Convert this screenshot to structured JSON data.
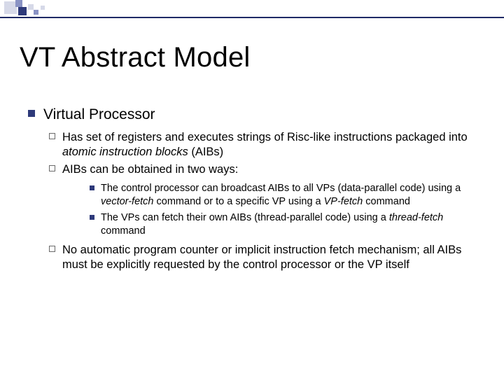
{
  "title": "VT Abstract Model",
  "lvl1": {
    "text": "Virtual Processor"
  },
  "lvl2": {
    "a_pre": "Has set of registers and executes strings of Risc-like instructions packaged into ",
    "a_em": "atomic instruction blocks",
    "a_post": " (AIBs)",
    "b": "AIBs can be obtained in two ways:",
    "c": "No automatic program counter or implicit instruction fetch mechanism; all AIBs must be explicitly requested by the control processor or the VP itself"
  },
  "lvl3": {
    "a_pre": "The control processor can broadcast AIBs to all VPs (data-parallel code) using a ",
    "a_em1": "vector-fetch",
    "a_mid": " command or to a specific VP using a ",
    "a_em2": "VP-fetch",
    "a_post": " command",
    "b_pre": "The VPs can fetch their own AIBs (thread-parallel code) using a ",
    "b_em": "thread-fetch",
    "b_post": " command"
  }
}
